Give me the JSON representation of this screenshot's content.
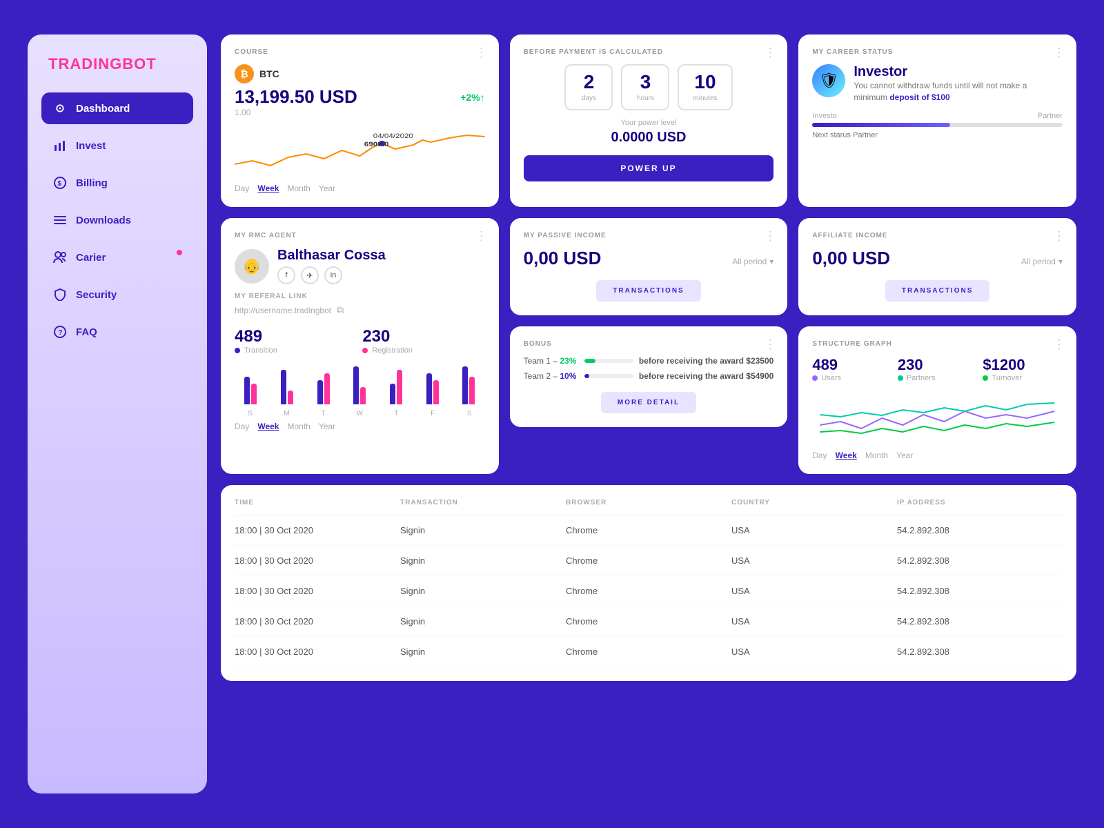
{
  "app": {
    "logo_brand": "TRADING",
    "logo_accent": "BOT"
  },
  "sidebar": {
    "items": [
      {
        "id": "dashboard",
        "label": "Dashboard",
        "icon": "⊙",
        "active": true,
        "badge": false
      },
      {
        "id": "invest",
        "label": "Invest",
        "icon": "📊",
        "active": false,
        "badge": false
      },
      {
        "id": "billing",
        "label": "Billing",
        "icon": "💲",
        "active": false,
        "badge": false
      },
      {
        "id": "downloads",
        "label": "Downloads",
        "icon": "☰",
        "active": false,
        "badge": false
      },
      {
        "id": "carier",
        "label": "Carier",
        "icon": "👥",
        "active": false,
        "badge": true
      },
      {
        "id": "security",
        "label": "Security",
        "icon": "🛡",
        "active": false,
        "badge": false
      },
      {
        "id": "faq",
        "label": "FAQ",
        "icon": "❓",
        "active": false,
        "badge": false
      }
    ]
  },
  "course_card": {
    "title": "COURSE",
    "coin": "BTC",
    "price": "13,199.50 USD",
    "change": "+2%↑",
    "base": "1.00",
    "date": "04/04/2020",
    "chart_label": "6900.0",
    "nav": [
      "Day",
      "Week",
      "Month",
      "Year"
    ],
    "active_nav": "Week"
  },
  "payment_card": {
    "title": "BEFORE PAYMENT IS CALCULATED",
    "days_num": "2",
    "days_label": "days",
    "hours_num": "3",
    "hours_label": "hours",
    "minutes_num": "10",
    "minutes_label": "minutes",
    "power_level_label": "Your power level",
    "power_level_value": "0.0000 USD",
    "button_label": "POWER UP"
  },
  "career_card": {
    "title": "MY CAREER STATUS",
    "status_name": "Investor",
    "description": "You cannot withdraw funds until will not make a minimum",
    "link_text": "deposit of $100",
    "progress_start": "Investo",
    "progress_end": "Partner",
    "next_status": "Next starus Partner",
    "progress_pct": 55
  },
  "rmc_agent_card": {
    "title": "MY RMC AGENT",
    "agent_name": "Balthasar Cossa",
    "social": [
      "f",
      "✈",
      "in"
    ],
    "referal_title": "MY REFERAL LINK",
    "referal_url": "http://username.tradingbot",
    "stats": [
      {
        "num": "489",
        "label": "Transition",
        "dot": "blue"
      },
      {
        "num": "230",
        "label": "Registration",
        "dot": "pink"
      }
    ],
    "bars": [
      {
        "blue": 40,
        "pink": 30
      },
      {
        "blue": 50,
        "pink": 20
      },
      {
        "blue": 35,
        "pink": 45
      },
      {
        "blue": 55,
        "pink": 25
      },
      {
        "blue": 30,
        "pink": 50
      },
      {
        "blue": 45,
        "pink": 35
      },
      {
        "blue": 55,
        "pink": 40
      }
    ],
    "days": [
      "S",
      "M",
      "T",
      "W",
      "T",
      "F",
      "S"
    ],
    "nav": [
      "Day",
      "Week",
      "Month",
      "Year"
    ],
    "active_nav": "Week"
  },
  "passive_income_card": {
    "title": "MY PASSIVE INCOME",
    "amount": "0,00 USD",
    "period_label": "All period",
    "button_label": "TRANSACTIONS"
  },
  "affiliate_income_card": {
    "title": "AFFILIATE INCOME",
    "amount": "0,00 USD",
    "period_label": "All period",
    "button_label": "TRANSACTIONS"
  },
  "bonus_card": {
    "title": "BONUS",
    "teams": [
      {
        "label": "Team 1 –",
        "pct": "23%",
        "pct_color": "green",
        "fill_pct": 23,
        "fill_type": "green",
        "award": "before receiving the award $23500"
      },
      {
        "label": "Team 2 –",
        "pct": "10%",
        "pct_color": "blue",
        "fill_pct": 10,
        "fill_type": "blue",
        "award": "before receiving the award $54900"
      }
    ],
    "button_label": "MORE DETAIL"
  },
  "structure_graph_card": {
    "title": "STRUCTURE GRAPH",
    "stats": [
      {
        "num": "489",
        "label": "Users",
        "dot": "purple"
      },
      {
        "num": "230",
        "label": "Partners",
        "dot": "teal"
      },
      {
        "num": "$1200",
        "label": "Turnover",
        "dot": "green"
      }
    ],
    "nav": [
      "Day",
      "Week",
      "Month",
      "Year"
    ],
    "active_nav": "Week"
  },
  "table": {
    "headers": [
      "TIME",
      "TRANSACTION",
      "BROWSER",
      "COUNTRY",
      "IP ADDRESS"
    ],
    "rows": [
      {
        "time": "18:00 | 30 Oct 2020",
        "transaction": "Signin",
        "browser": "Chrome",
        "country": "USA",
        "ip": "54.2.892.308"
      },
      {
        "time": "18:00 | 30 Oct 2020",
        "transaction": "Signin",
        "browser": "Chrome",
        "country": "USA",
        "ip": "54.2.892.308"
      },
      {
        "time": "18:00 | 30 Oct 2020",
        "transaction": "Signin",
        "browser": "Chrome",
        "country": "USA",
        "ip": "54.2.892.308"
      },
      {
        "time": "18:00 | 30 Oct 2020",
        "transaction": "Signin",
        "browser": "Chrome",
        "country": "USA",
        "ip": "54.2.892.308"
      },
      {
        "time": "18:00 | 30 Oct 2020",
        "transaction": "Signin",
        "browser": "Chrome",
        "country": "USA",
        "ip": "54.2.892.308"
      }
    ]
  }
}
